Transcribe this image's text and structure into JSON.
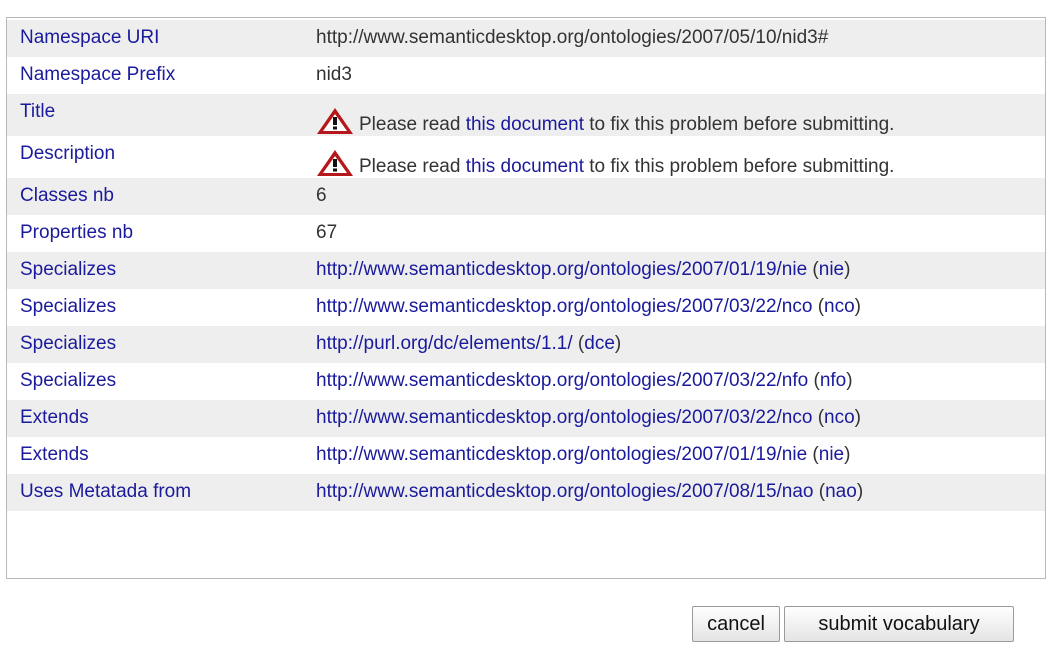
{
  "rows": [
    {
      "label": "Namespace URI",
      "value": "http://www.semanticdesktop.org/ontologies/2007/05/10/nid3#"
    },
    {
      "label": "Namespace Prefix",
      "value": "nid3"
    },
    {
      "label": "Title",
      "warning": {
        "icon": "warning-triangle-icon",
        "before": "Please read ",
        "link": "this document",
        "after": " to fix this problem before submitting."
      }
    },
    {
      "label": "Description",
      "warning": {
        "icon": "warning-triangle-icon",
        "before": "Please read ",
        "link": "this document",
        "after": " to fix this problem before submitting."
      }
    },
    {
      "label": "Classes nb",
      "value": "6"
    },
    {
      "label": "Properties nb",
      "value": "67"
    },
    {
      "label": "Specializes",
      "link": "http://www.semanticdesktop.org/ontologies/2007/01/19/nie",
      "prefix": "nie"
    },
    {
      "label": "Specializes",
      "link": "http://www.semanticdesktop.org/ontologies/2007/03/22/nco",
      "prefix": "nco"
    },
    {
      "label": "Specializes",
      "link": "http://purl.org/dc/elements/1.1/",
      "prefix": "dce"
    },
    {
      "label": "Specializes",
      "link": "http://www.semanticdesktop.org/ontologies/2007/03/22/nfo",
      "prefix": "nfo"
    },
    {
      "label": "Extends",
      "link": "http://www.semanticdesktop.org/ontologies/2007/03/22/nco",
      "prefix": "nco"
    },
    {
      "label": "Extends",
      "link": "http://www.semanticdesktop.org/ontologies/2007/01/19/nie",
      "prefix": "nie"
    },
    {
      "label": "Uses Metatada from",
      "link": "http://www.semanticdesktop.org/ontologies/2007/08/15/nao",
      "prefix": "nao"
    }
  ],
  "buttons": {
    "cancel": "cancel",
    "submit": "submit vocabulary"
  },
  "colors": {
    "label": "#1a1a9c",
    "text": "#333333",
    "alt_row": "#eeeeee",
    "warning_red": "#b5171b"
  }
}
